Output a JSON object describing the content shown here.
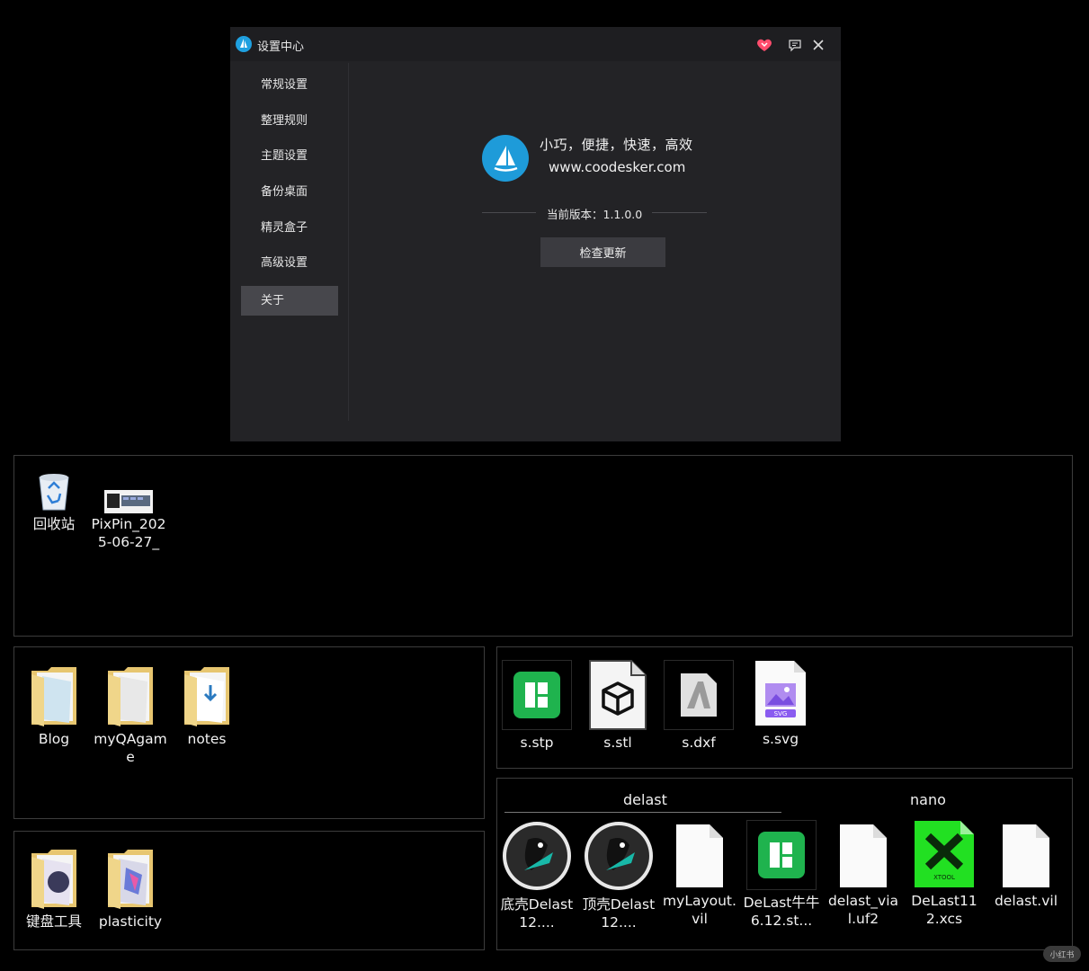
{
  "window": {
    "title": "设置中心",
    "nav": [
      "常规设置",
      "整理规则",
      "主题设置",
      "备份桌面",
      "精灵盒子",
      "高级设置",
      "关于"
    ],
    "active_nav": "关于",
    "about": {
      "slogan": "小巧，便捷，快速，高效",
      "url": "www.coodesker.com",
      "version": "当前版本：1.1.0.0",
      "check_button": "检查更新"
    }
  },
  "desktop": {
    "top_box": [
      {
        "label": "回收站",
        "icon": "recycle-bin-icon"
      },
      {
        "label": "PixPin_2025-06-27_",
        "icon": "image-thumbnail-icon"
      }
    ],
    "folders_box": [
      {
        "label": "Blog",
        "icon": "folder-icon"
      },
      {
        "label": "myQAgame",
        "icon": "folder-icon"
      },
      {
        "label": "notes",
        "icon": "folder-icon"
      }
    ],
    "tools_box": [
      {
        "label": "键盘工具",
        "icon": "folder-icon"
      },
      {
        "label": "plasticity",
        "icon": "folder-icon"
      }
    ],
    "cad_box": [
      {
        "label": "s.stp",
        "icon": "green-app-icon"
      },
      {
        "label": "s.stl",
        "icon": "cube-file-icon"
      },
      {
        "label": "s.dxf",
        "icon": "autocad-icon"
      },
      {
        "label": "s.svg",
        "icon": "svg-file-icon"
      }
    ],
    "delast_box": {
      "groups": [
        "delast",
        "nano"
      ],
      "items": [
        {
          "label": "底壳Delast12....",
          "icon": "penguin-icon"
        },
        {
          "label": "顶壳Delast12....",
          "icon": "penguin-icon"
        },
        {
          "label": "myLayout.vil",
          "icon": "blank-file-icon"
        },
        {
          "label": "DeLast牛牛 6.12.st...",
          "icon": "green-app-icon"
        },
        {
          "label": "delast_vial.uf2",
          "icon": "blank-file-icon"
        },
        {
          "label": "DeLast112.xcs",
          "icon": "xtool-icon"
        },
        {
          "label": "delast.vil",
          "icon": "blank-file-icon"
        }
      ]
    }
  },
  "watermark": "小红书"
}
